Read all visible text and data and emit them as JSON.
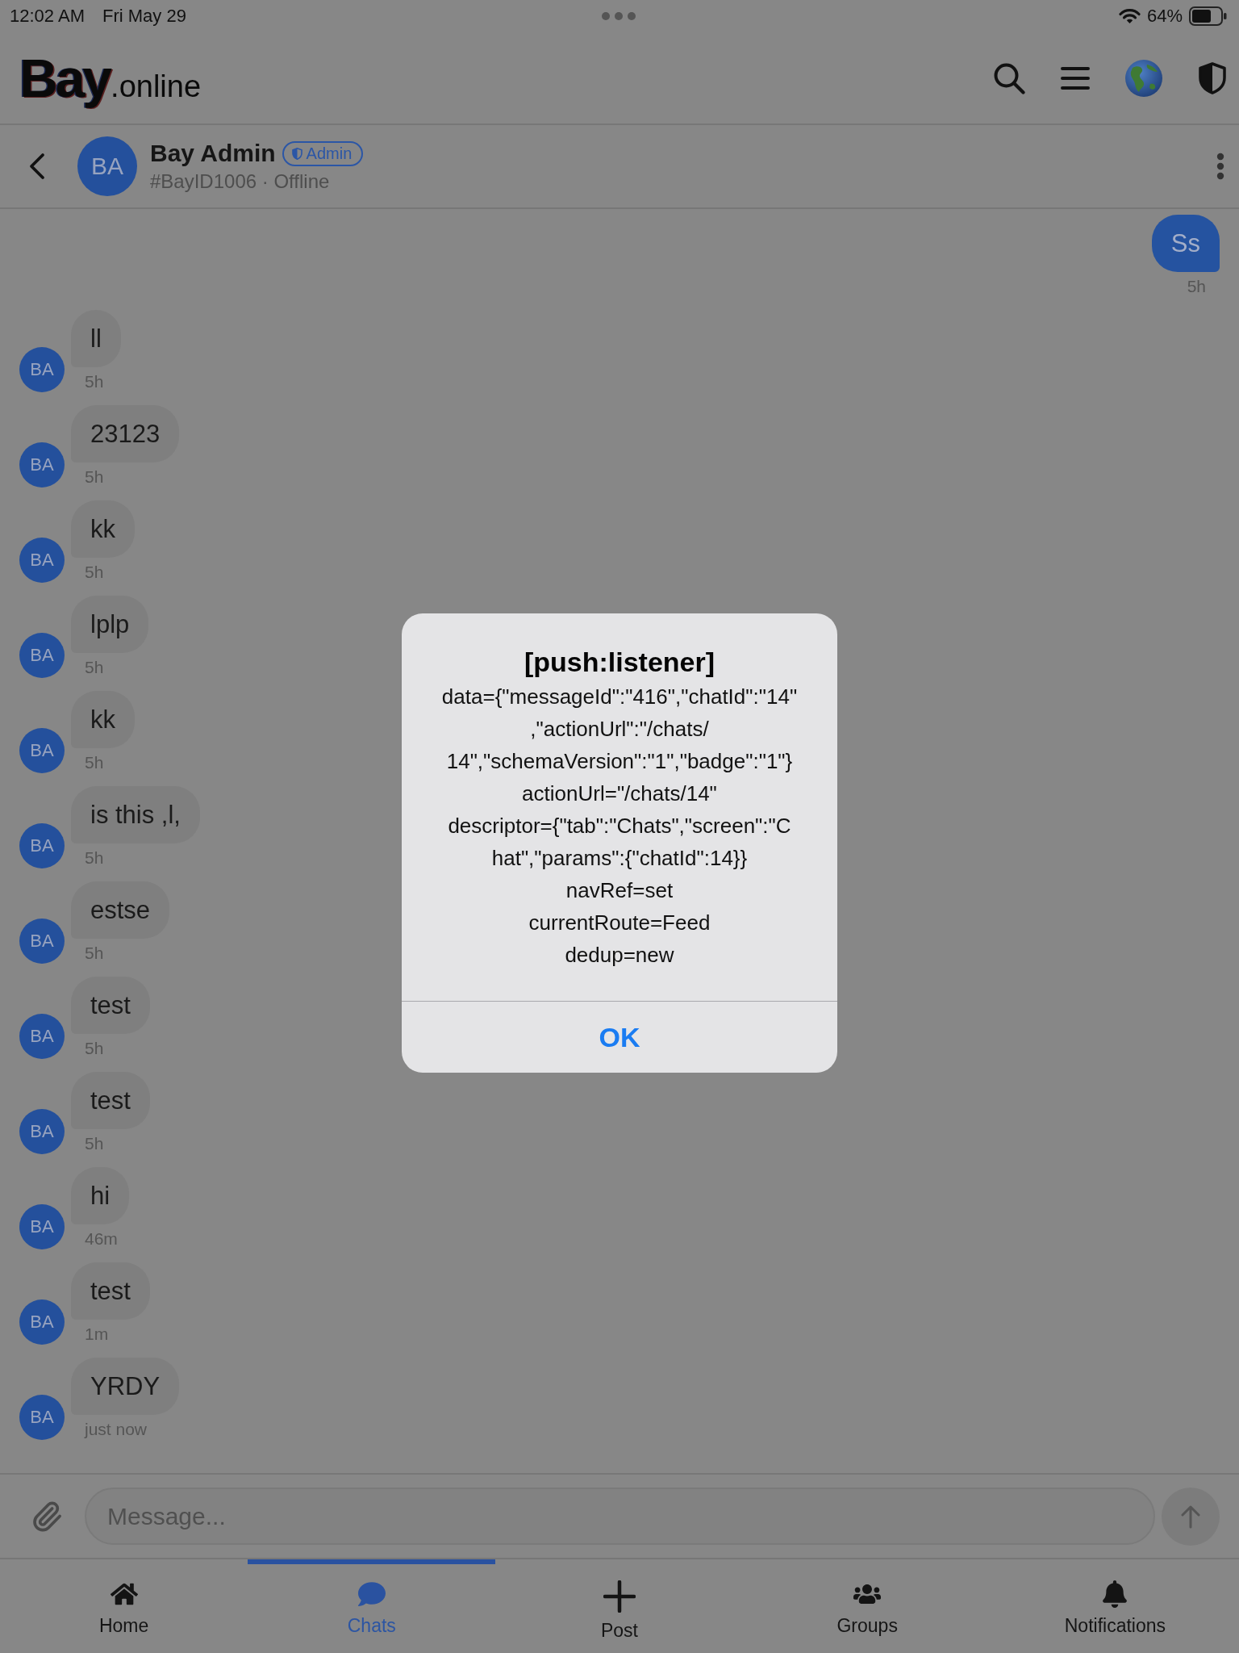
{
  "status_bar": {
    "time": "12:02 AM",
    "date": "Fri May 29",
    "battery": "64%"
  },
  "header": {
    "logo": {
      "word": "Bay",
      "suffix": ".online"
    }
  },
  "chat_header": {
    "avatar": "BA",
    "name": "Bay Admin",
    "badge": "Admin",
    "subtitle": "#BayID1006 · Offline"
  },
  "messages": [
    {
      "kind": "outgoing",
      "text": "Ss",
      "time": "5h"
    },
    {
      "kind": "incoming",
      "avatar": "BA",
      "text": "ll",
      "time": "5h"
    },
    {
      "kind": "incoming",
      "avatar": "BA",
      "text": "23123",
      "time": "5h"
    },
    {
      "kind": "incoming",
      "avatar": "BA",
      "text": "kk",
      "time": "5h"
    },
    {
      "kind": "incoming",
      "avatar": "BA",
      "text": "lplp",
      "time": "5h"
    },
    {
      "kind": "incoming",
      "avatar": "BA",
      "text": "kk",
      "time": "5h"
    },
    {
      "kind": "incoming",
      "avatar": "BA",
      "text": "is this ,l,",
      "time": "5h"
    },
    {
      "kind": "incoming",
      "avatar": "BA",
      "text": "estse",
      "time": "5h"
    },
    {
      "kind": "incoming",
      "avatar": "BA",
      "text": "test",
      "time": "5h"
    },
    {
      "kind": "incoming",
      "avatar": "BA",
      "text": "test",
      "time": "5h"
    },
    {
      "kind": "incoming",
      "avatar": "BA",
      "text": "hi",
      "time": "46m"
    },
    {
      "kind": "incoming",
      "avatar": "BA",
      "text": "test",
      "time": "1m"
    },
    {
      "kind": "incoming",
      "avatar": "BA",
      "text": "YRDY",
      "time": "just now"
    }
  ],
  "composer": {
    "placeholder": "Message..."
  },
  "tabs": [
    {
      "label": "Home",
      "selected": false
    },
    {
      "label": "Chats",
      "selected": true
    },
    {
      "label": "Post",
      "selected": false
    },
    {
      "label": "Groups",
      "selected": false
    },
    {
      "label": "Notifications",
      "selected": false
    }
  ],
  "alert": {
    "title": "[push:listener]",
    "message_lines": [
      "data={\"messageId\":\"416\",\"chatId\":\"14\"",
      ",\"actionUrl\":\"/chats/",
      "14\",\"schemaVersion\":\"1\",\"badge\":\"1\"}",
      "actionUrl=\"/chats/14\"",
      "descriptor={\"tab\":\"Chats\",\"screen\":\"C",
      "hat\",\"params\":{\"chatId\":14}}",
      "navRef=set",
      "currentRoute=Feed",
      "dedup=new"
    ],
    "button": "OK"
  }
}
